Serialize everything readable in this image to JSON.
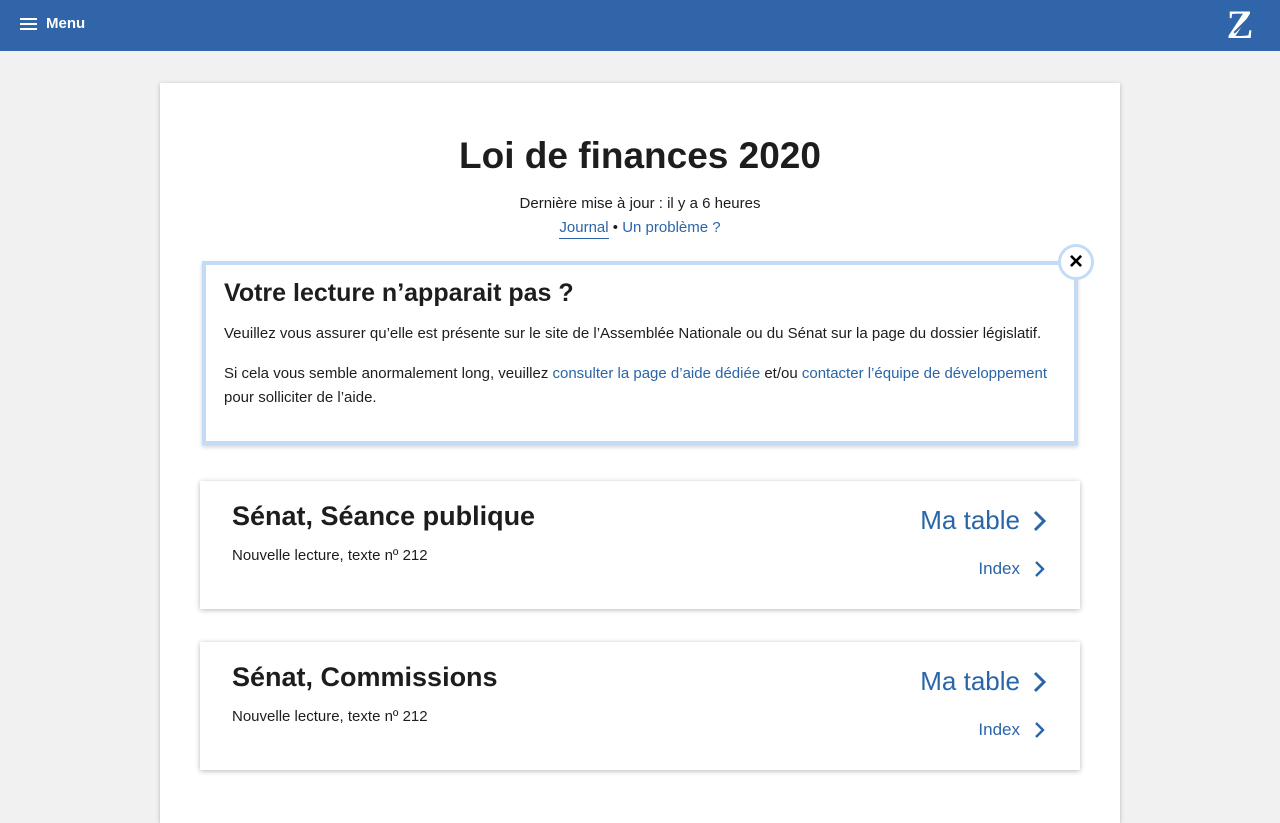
{
  "header": {
    "menu_label": "Menu",
    "logo_letter": "Z",
    "bar_color": "#3165a9"
  },
  "page": {
    "title": "Loi de finances 2020",
    "updated": "Dernière mise à jour : il y a 6 heures",
    "journal_link": "Journal",
    "separator": "•",
    "problem_link": "Un problème ?"
  },
  "alert": {
    "title": "Votre lecture n’apparait pas ?",
    "p1": "Veuillez vous assurer qu’elle est présente sur le site de l’Assemblée Nationale ou du Sénat sur la page du dossier législatif.",
    "p2_before": "Si cela vous semble anormalement long, veuillez ",
    "p2_link1": "consulter la page d’aide dédiée",
    "p2_middle": " et/ou ",
    "p2_link2": "contacter l’équipe de développement",
    "p2_after": " pour solliciter de l’aide.",
    "close_symbol": "×"
  },
  "readings": [
    {
      "title": "Sénat, Séance publique",
      "subtitle": "Nouvelle lecture, texte nº 212",
      "primary_action": "Ma table",
      "secondary_action": "Index"
    },
    {
      "title": "Sénat, Commissions",
      "subtitle": "Nouvelle lecture, texte nº 212",
      "primary_action": "Ma table",
      "secondary_action": "Index"
    }
  ],
  "colors": {
    "link": "#2a65a8",
    "alert_border": "#c2dcf6",
    "background": "#f1f1f1"
  }
}
